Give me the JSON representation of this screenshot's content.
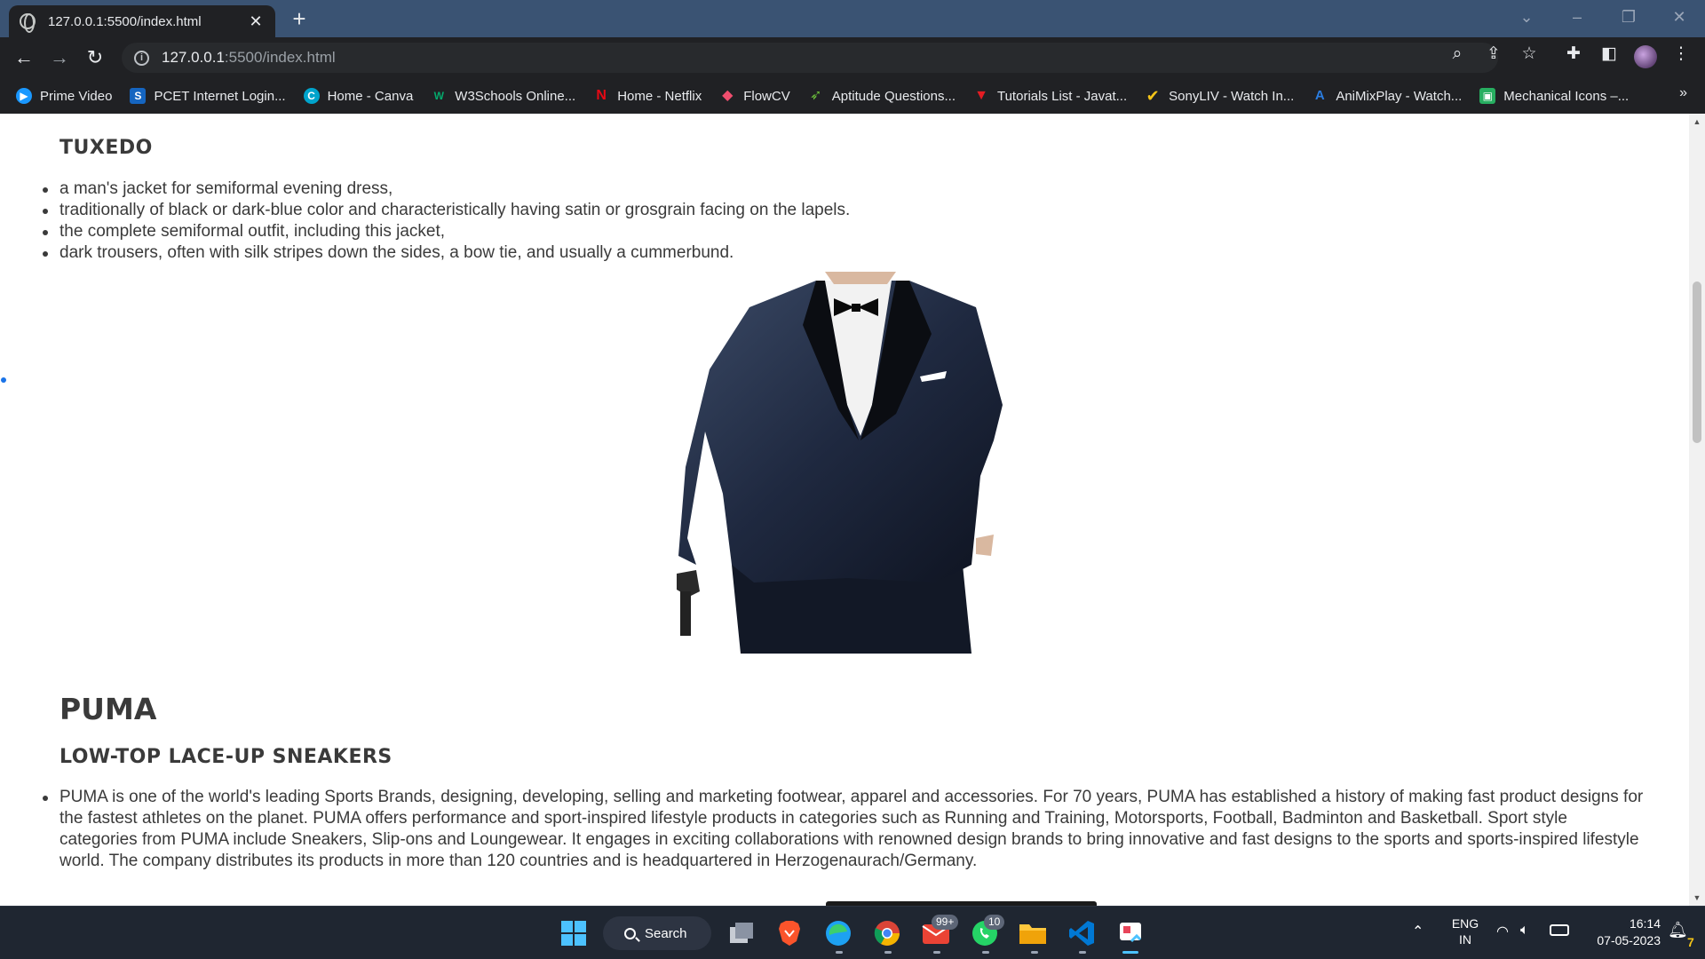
{
  "browser": {
    "tab_title": "127.0.0.1:5500/index.html",
    "tab_close": "✕",
    "new_tab": "+",
    "url_host": "127.0.0.1",
    "url_path": ":5500/index.html",
    "bookmarks": [
      {
        "label": "Prime Video",
        "icon": "prime-video-icon",
        "color": "#1a98ff",
        "glyph": "▶"
      },
      {
        "label": "PCET Internet Login...",
        "icon": "pcet-icon",
        "color": "#1565c0",
        "glyph": "S"
      },
      {
        "label": "Home - Canva",
        "icon": "canva-icon",
        "color": "#00c4cc",
        "glyph": "C"
      },
      {
        "label": "W3Schools Online...",
        "icon": "w3schools-icon",
        "color": "#04aa6d",
        "glyph": "W"
      },
      {
        "label": "Home - Netflix",
        "icon": "netflix-icon",
        "color": "#e50914",
        "glyph": "N"
      },
      {
        "label": "FlowCV",
        "icon": "flowcv-icon",
        "color": "#f04e6e",
        "glyph": "◆"
      },
      {
        "label": "Aptitude Questions...",
        "icon": "aptitude-icon",
        "color": "#6bbf3b",
        "glyph": "➶"
      },
      {
        "label": "Tutorials List - Javat...",
        "icon": "javatpoint-icon",
        "color": "#e41c23",
        "glyph": "▼"
      },
      {
        "label": "SonyLIV - Watch In...",
        "icon": "sonyliv-icon",
        "color": "#f5c518",
        "glyph": "✔"
      },
      {
        "label": "AniMixPlay - Watch...",
        "icon": "animixplay-icon",
        "color": "#2a7de1",
        "glyph": "A"
      },
      {
        "label": "Mechanical Icons –...",
        "icon": "mechanical-icons-icon",
        "color": "#27ae60",
        "glyph": "▣"
      }
    ],
    "bookmarks_more": "»"
  },
  "page": {
    "tuxedo_heading": "TUXEDO",
    "tuxedo_items": [
      "a man's jacket for semiformal evening dress,",
      "traditionally of black or dark-blue color and characteristically having satin or grosgrain facing on the lapels.",
      "the complete semiformal outfit, including this jacket,",
      "dark trousers, often with silk stripes down the sides, a bow tie, and usually a cummerbund."
    ],
    "puma_title": "PUMA",
    "puma_heading": "LOW-TOP LACE-UP SNEAKERS",
    "puma_items": [
      "PUMA is one of the world's leading Sports Brands, designing, developing, selling and marketing footwear, apparel and accessories. For 70 years, PUMA has established a history of making fast product designs for the fastest athletes on the planet. PUMA offers performance and sport-inspired lifestyle products in categories such as Running and Training, Motorsports, Football, Badminton and Basketball. Sport style categories from PUMA include Sneakers, Slip-ons and Loungewear. It engages in exciting collaborations with renowned design brands to bring innovative and fast designs to the sports and sports-inspired lifestyle world. The company distributes its products in more than 120 countries and is headquartered in Herzogenaurach/Germany."
    ]
  },
  "taskbar": {
    "search_label": "Search",
    "mail_badge": "99+",
    "whatsapp_badge": "10",
    "lang": "ENG",
    "region": "IN",
    "time": "16:14",
    "date": "07-05-2023",
    "notif_count": "7"
  },
  "colors": {
    "titlebar": "#3a5373",
    "chrome_dark": "#202124",
    "text": "#3a3a3a",
    "taskbar": "#1f2631"
  }
}
